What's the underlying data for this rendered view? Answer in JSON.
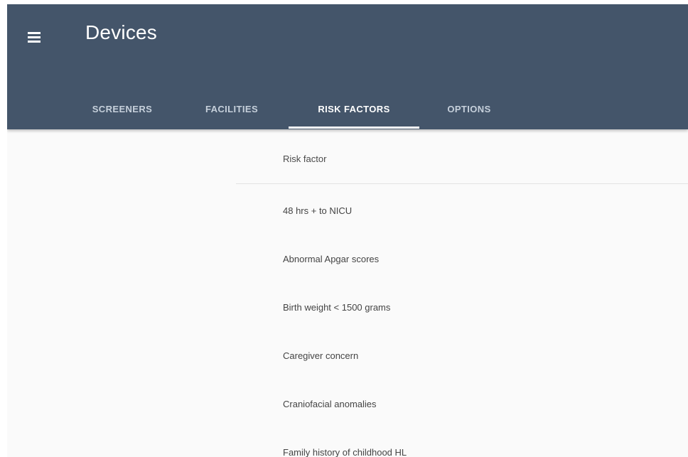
{
  "app_bar": {
    "title": "Devices",
    "menu_icon": "menu-icon",
    "background_color": "#44556a"
  },
  "tabs": [
    {
      "label": "SCREENERS",
      "active": false
    },
    {
      "label": "FACILITIES",
      "active": false
    },
    {
      "label": "RISK FACTORS",
      "active": true
    },
    {
      "label": "OPTIONS",
      "active": false
    }
  ],
  "table": {
    "column_header": "Risk factor",
    "rows": [
      "48 hrs + to NICU",
      "Abnormal Apgar scores",
      "Birth weight < 1500 grams",
      "Caregiver concern",
      "Craniofacial anomalies",
      "Family history of childhood HL"
    ]
  }
}
